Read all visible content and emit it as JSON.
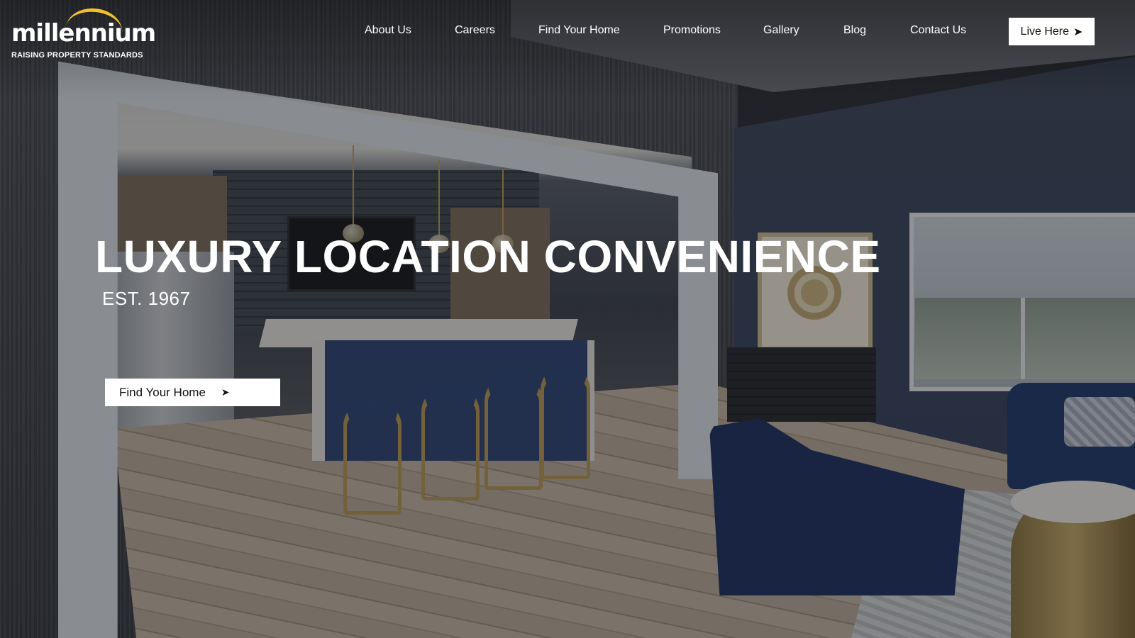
{
  "brand": {
    "name": "millennium",
    "tagline": "RAISING PROPERTY STANDARDS",
    "accent_color": "#f2c12e"
  },
  "nav": {
    "items": [
      {
        "label": "About Us"
      },
      {
        "label": "Careers"
      },
      {
        "label": "Find Your Home"
      },
      {
        "label": "Promotions"
      },
      {
        "label": "Gallery"
      },
      {
        "label": "Blog"
      },
      {
        "label": "Contact Us"
      }
    ],
    "cta_label": "Live Here",
    "cta_icon": "chevron-right-icon"
  },
  "hero": {
    "headline": "LUXURY LOCATION CONVENIENCE",
    "subheadline": "EST. 1967",
    "button_label": "Find Your Home",
    "button_icon": "chevron-right-icon"
  }
}
